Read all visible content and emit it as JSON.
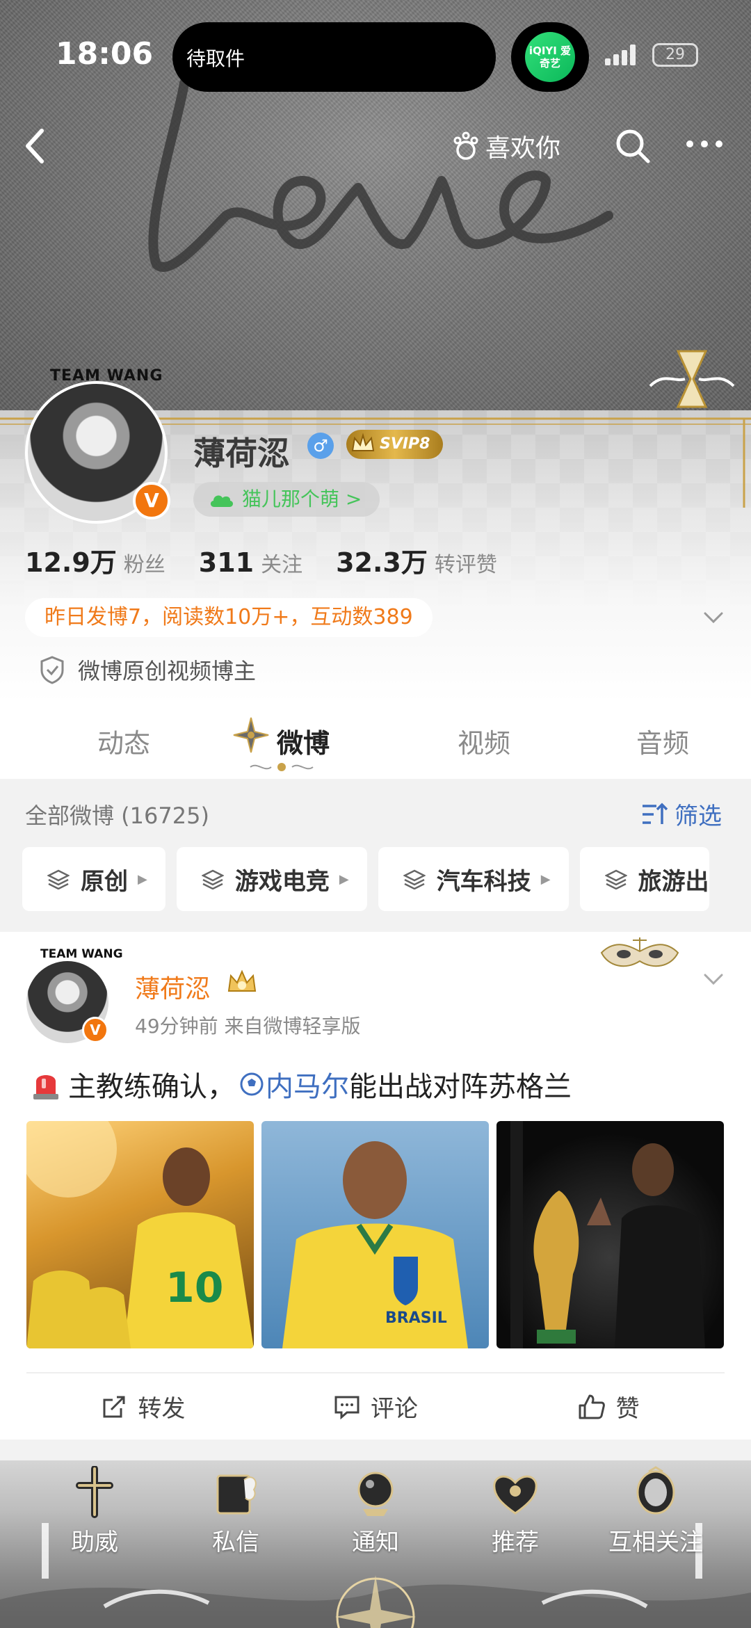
{
  "status_bar": {
    "time": "18:06",
    "island_text": "待取件",
    "app_badge": "iQIYI 爱奇艺",
    "battery": "29"
  },
  "nav": {
    "like_you": "喜欢你"
  },
  "profile": {
    "avatar_team": "TEAM WANG",
    "verify_badge": "V",
    "name": "薄荷涊",
    "gender_symbol": "♂",
    "svip": "SVIP8",
    "tag": "猫儿那个萌 >",
    "stats": [
      {
        "num": "12.9万",
        "label": "粉丝"
      },
      {
        "num": "311",
        "label": "关注"
      },
      {
        "num": "32.3万",
        "label": "转评赞"
      }
    ],
    "yesterday": "昨日发博7，阅读数10万+，互动数389",
    "original": "微博原创视频博主"
  },
  "tabs": [
    {
      "label": "动态"
    },
    {
      "label": "微博"
    },
    {
      "label": "视频"
    },
    {
      "label": "音频"
    }
  ],
  "filter": {
    "all_weibo": "全部微博 (16725)",
    "filter_label": "筛选",
    "chips": [
      {
        "label": "原创"
      },
      {
        "label": "游戏电竞"
      },
      {
        "label": "汽车科技"
      },
      {
        "label": "旅游出"
      }
    ]
  },
  "post": {
    "avatar_team": "TEAM WANG",
    "verify_badge": "V",
    "name": "薄荷涊",
    "meta": "49分钟前   来自微博轻享版",
    "text_before": "主教练确认，",
    "link": "内马尔",
    "text_after": "能出战对阵苏格兰",
    "actions": [
      {
        "label": "转发"
      },
      {
        "label": "评论"
      },
      {
        "label": "赞"
      }
    ]
  },
  "bottom_bar": [
    {
      "label": "助威"
    },
    {
      "label": "私信"
    },
    {
      "label": "通知"
    },
    {
      "label": "推荐"
    },
    {
      "label": "互相关注"
    }
  ],
  "colors": {
    "accent_orange": "#f07a1a",
    "link_blue": "#3f6fc0",
    "vip_gold": "#e4b84c",
    "verify_orange": "#f2760e"
  }
}
